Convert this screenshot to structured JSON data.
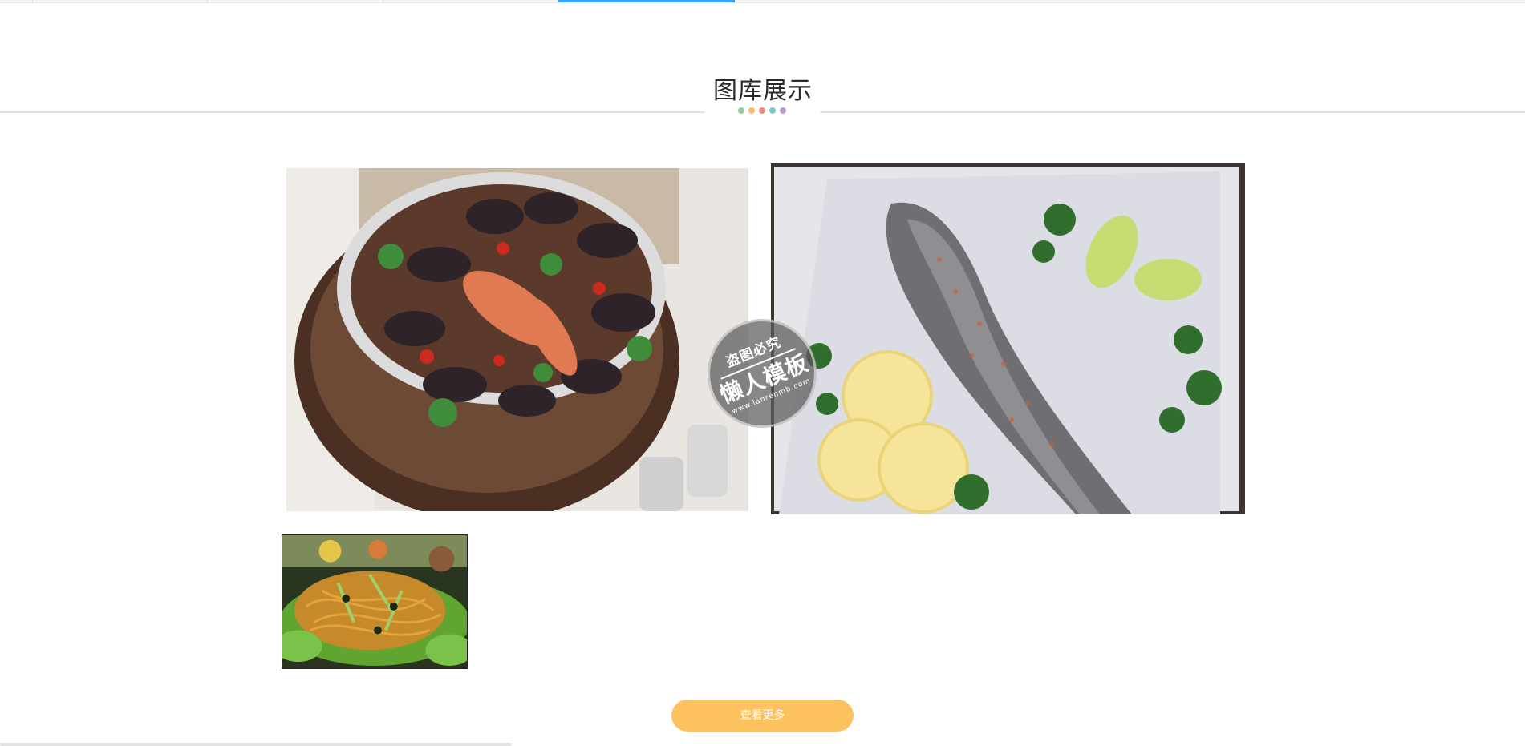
{
  "nav": {
    "active_color": "#3aa3f0"
  },
  "section": {
    "title": "图库展示",
    "dot_colors": [
      "#9ac99a",
      "#f6c06a",
      "#ef8c78",
      "#7fcac6",
      "#b89ad0"
    ]
  },
  "gallery": {
    "items": [
      {
        "name": "seafood-bowl-image",
        "icon": "mussels-prawns-bowl"
      },
      {
        "name": "raw-trout-image",
        "icon": "trout-lemon-herbs"
      },
      {
        "name": "fried-noodles-image",
        "icon": "noodles-lettuce"
      }
    ]
  },
  "watermark": {
    "top": "盗图必究",
    "main": "懒人模板",
    "url": "www.lanrenmb.com"
  },
  "more_button": {
    "label": "查看更多",
    "color": "#fcc25e"
  }
}
